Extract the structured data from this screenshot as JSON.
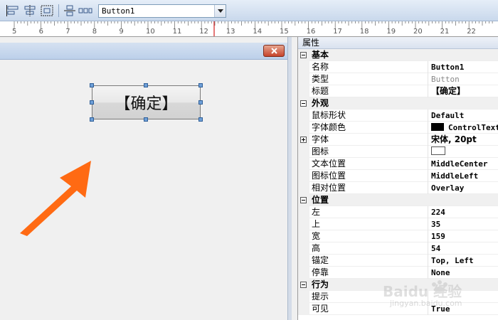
{
  "toolbar": {
    "buttons": [
      "align-left-icon",
      "align-center-icon",
      "size-select-icon",
      "align-vertical-icon",
      "distribute-horizontal-icon"
    ],
    "component_select": {
      "value": "Button1"
    }
  },
  "ruler": {
    "marks": [
      "5",
      "6",
      "7",
      "8",
      "9",
      "10",
      "11",
      "12",
      "13",
      "14",
      "15",
      "16",
      "17",
      "18",
      "19",
      "20",
      "21",
      "22"
    ]
  },
  "designer": {
    "close_icon": "close-icon",
    "button_caption": "【确定】",
    "arrow_color": "#ff6a13"
  },
  "properties": {
    "header": "属性",
    "categories": [
      {
        "name": "基本",
        "rows": [
          {
            "name": "名称",
            "value": "Button1",
            "style": "normal"
          },
          {
            "name": "类型",
            "value": "Button",
            "style": "grey"
          },
          {
            "name": "标题",
            "value": "【确定】",
            "style": "cjk"
          }
        ]
      },
      {
        "name": "外观",
        "rows": [
          {
            "name": "鼠标形状",
            "value": "Default",
            "style": "normal"
          },
          {
            "name": "字体颜色",
            "value": "ControlText",
            "style": "swatch"
          },
          {
            "name": "字体",
            "value": "宋体, 20pt",
            "style": "cjk"
          },
          {
            "name": "图标",
            "value": "",
            "style": "iconbox"
          },
          {
            "name": "文本位置",
            "value": "MiddleCenter",
            "style": "normal"
          },
          {
            "name": "图标位置",
            "value": "MiddleLeft",
            "style": "normal"
          },
          {
            "name": "相对位置",
            "value": "Overlay",
            "style": "normal"
          }
        ]
      },
      {
        "name": "位置",
        "rows": [
          {
            "name": "左",
            "value": "224",
            "style": "normal"
          },
          {
            "name": "上",
            "value": "35",
            "style": "normal"
          },
          {
            "name": "宽",
            "value": "159",
            "style": "normal"
          },
          {
            "name": "高",
            "value": "54",
            "style": "normal"
          },
          {
            "name": "锚定",
            "value": "Top, Left",
            "style": "normal"
          },
          {
            "name": "停靠",
            "value": "None",
            "style": "normal"
          }
        ]
      },
      {
        "name": "行为",
        "rows": [
          {
            "name": "提示",
            "value": "",
            "style": "normal"
          },
          {
            "name": "可见",
            "value": "True",
            "style": "normal"
          }
        ]
      }
    ]
  },
  "watermark": {
    "brand": "Baidu 经验",
    "url": "jingyan.baidu.com"
  }
}
